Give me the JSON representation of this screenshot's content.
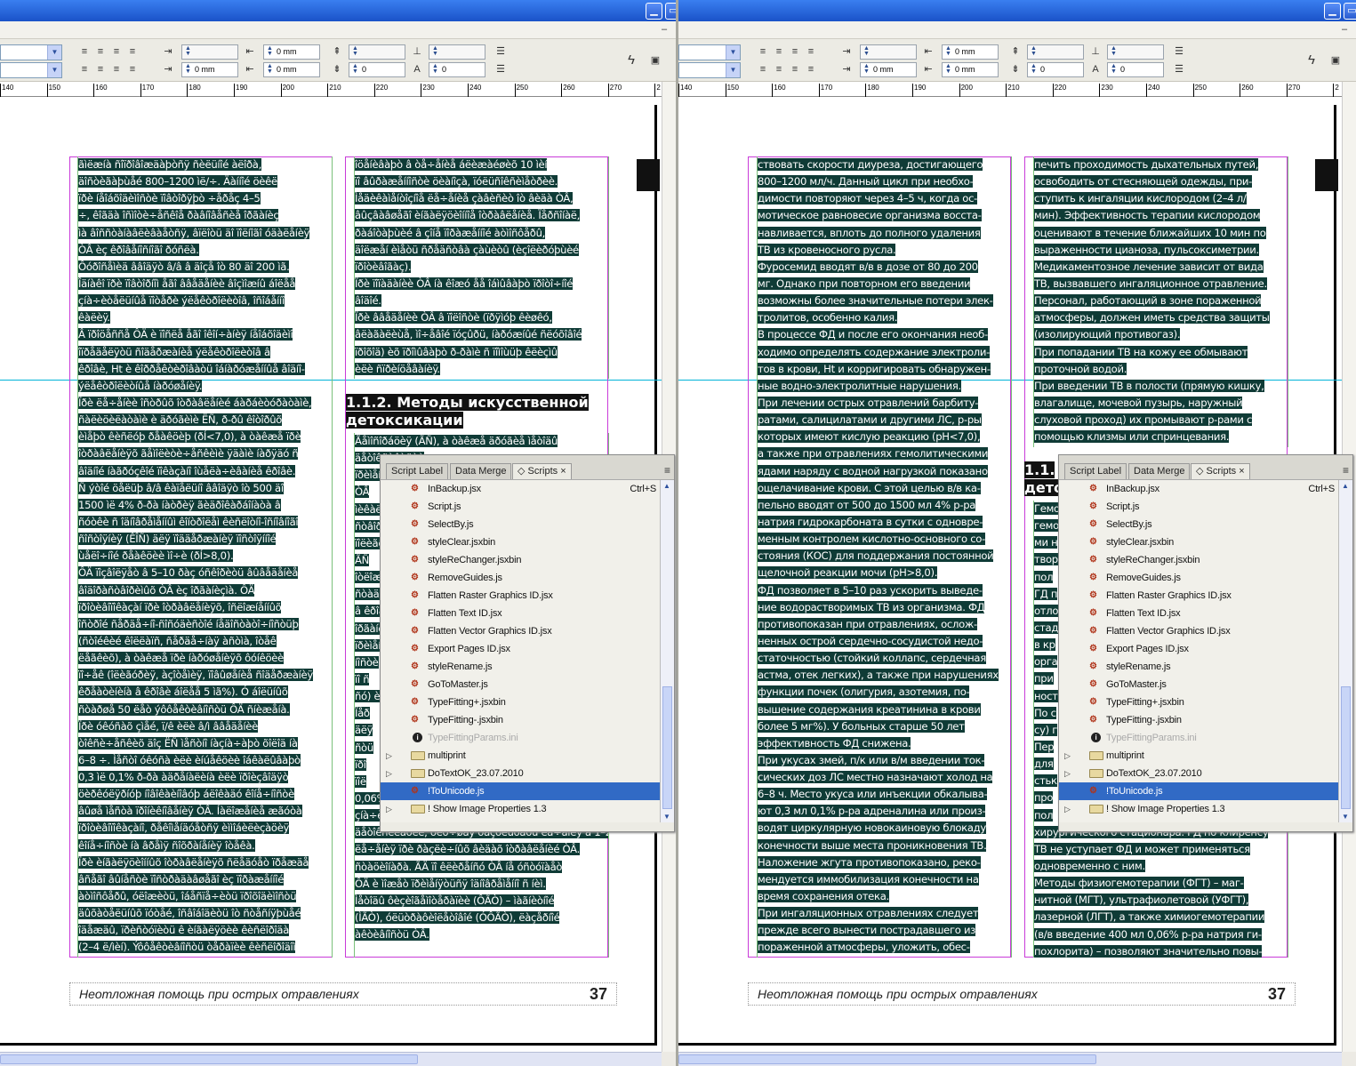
{
  "toolbar": {
    "row1": {
      "f1": "",
      "f2": "0 mm",
      "f3": "",
      "f4": ""
    },
    "row2": {
      "f1": "0 mm",
      "f2": "0 mm",
      "f3": "0",
      "f4": "0"
    }
  },
  "ruler_ticks_left": [
    "140",
    "150",
    "160",
    "170",
    "180",
    "190",
    "200",
    "210",
    "220",
    "230",
    "240",
    "250",
    "260",
    "270",
    "2"
  ],
  "ruler_ticks_right": [
    "140",
    "150",
    "160",
    "170",
    "180",
    "190",
    "200",
    "210",
    "220",
    "230",
    "240",
    "250",
    "260",
    "270",
    "2"
  ],
  "left_page": {
    "col1_lines": [
      "ãìëæíà ñîïðîâîæäàþòñÿ ñèëüíîé àëîðà,",
      "äîñòèãàþùåé 800–1200 ìë/÷. Äàííîé öèêë",
      "ïðè íåîáõîäèìîñòè ïîâòîðÿþò ÷åðåç 4–5",
      "÷, êîãäà îñìîòè÷åñêîå ðàâíîâåñèå îðãàíèç",
      "ìà âîññòàíàâëèâàåòñÿ, âïëîòü äî ïîëíîãî óäàëåíèÿ",
      "ÒÂ èç êðîâåíîñíîãî ðóñëà.",
      "Ôóðîñåìèä ââîäÿò â/â â äîçå îò 80 äî 200 ìã.",
      "Îäíàêî ïðè ïîâòîðíîì åãî ââåäåíèè âîçìîæíû áîëåå",
      "çíà÷èòåëüíûå ïîòåðè ýëåêòðîëèòîâ, îñîáåííî",
      "êàëèÿ.",
      "Â ïðîöåññå ÔÄ è ïîñëå åãî îêîí÷àíèÿ íåîáõîäèìî",
      "îïðåäåëÿòü ñîäåðæàíèå ýëåêòðîëèòîâ â",
      "êðîâè, Ht è êîððåêòèðîâàòü îáíàðóæåííûå âîäíî-",
      "ýëåêòðîëèòíûå íàðóøåíèÿ.",
      "Ïðè ëå÷åíèè îñòðûõ îòðàâëåíèé áàðáèòóðàòàìè,",
      "ñàëèöèëàòàìè è äðóãèìè ËÑ, ð-ðû êîòîðûõ",
      "èìåþò êèñëóþ ðåàêöèþ (ðÍ<7,0), à òàêæå ïðè",
      "îòðàâëåíèÿõ ãåìîëèòè÷åñêèìè ÿäàìè íàðÿäó ñ",
      "âîäíîé íàãðóçêîé ïîêàçàíî îùåëà÷èâàíèå êðîâè.",
      "Ñ ýòîé öåëüþ â/â êàïåëüíî ââîäÿò îò 500 äî",
      "1500 ìë 4% ð-ðà íàòðèÿ ãèäðîêàðáîíàòà â",
      "ñóòêè ñ îäíîâðåìåííûì êîíòðîëåì êèñëîòíî-îñíîâíîãî",
      "ñîñòîÿíèÿ (ÊÎÑ) äëÿ ïîääåðæàíèÿ ïîñòîÿííîé",
      "ùåëî÷íîé ðåàêöèè ìî÷è (ðÍ>8,0).",
      "ÔÄ ïîçâîëÿåò â 5–10 ðàç óñêîðèòü âûâåäåíèå",
      "âîäîðàñòâîðèìûõ ÒÂ èç îðãàíèçìà. ÔÄ",
      "ïðîòèâîïîêàçàí ïðè îòðàâëåíèÿõ, îñëîæíåííûõ",
      "îñòðîé ñåðäå÷íî-ñîñóäèñòîé íåäîñòàòî÷íîñòüþ",
      "(ñòîéêèé êîëëàïñ, ñåðäå÷íàÿ àñòìà, îòåê",
      "ëåãêèõ), à òàêæå ïðè íàðóøåíèÿõ ôóíêöèè",
      "ïî÷åê (îëèãóðèÿ, àçîòåìèÿ, ïîâûøåíèå ñîäåðæàíèÿ",
      "êðåàòèíèíà â êðîâè áîëåå 5 ìã%). Ó áîëüíûõ",
      "ñòàðøå 50 ëåò ýôôåêòèâíîñòü ÔÄ ñíèæåíà.",
      "Ïðè óêóñàõ çìåé, ï/ê èëè â/ì ââåäåíèè",
      "òîêñè÷åñêèõ äîç ËÑ ìåñòíî íàçíà÷àþò õîëîä íà",
      "6–8 ÷. Ìåñòî óêóñà èëè èíúåêöèè îáêàëûâàþò",
      "0,3 ìë 0,1% ð-ðà àäðåíàëèíà èëè ïðîèçâîäÿò",
      "öèðêóëÿðíóþ íîâîêàèíîâóþ áëîêàäó êîíå÷íîñòè",
      "âûøå ìåñòà ïðîíèêíîâåíèÿ ÒÂ. Íàëîæåíèå æãóòà",
      "ïðîòèâîïîêàçàíî, ðåêîìåíäóåòñÿ èììîáèëèçàöèÿ",
      "êîíå÷íîñòè íà âðåìÿ ñîõðàíåíèÿ îòåêà.",
      "Ïðè èíãàëÿöèîííûõ îòðàâëåíèÿõ ñëåäóåò ïðåæäå",
      "âñåãî âûíåñòè ïîñòðàäàâøåãî èç ïîðàæåííîé",
      "àòìîñôåðû, óëîæèòü, îáåñïå÷èòü ïðîõîäèìîñòü",
      "äûõàòåëüíûõ ïóòåé, îñâîáîäèòü îò ñòåñíÿþùåé",
      "îäåæäû, ïðèñòóïèòü ê èíãàëÿöèè êèñëîðîäà",
      "(2–4 ë/ìèí). Ýôôåêòèâíîñòü òåðàïèè êèñëîðîäîì"
    ],
    "col2_lines": [
      "îöåíèâàþò â òå÷åíèå áëèæàéøèõ 10 ìèí",
      "ïî âûðàæåííîñòè öèàíîçà, ïóëüñîêñèìåòðèè.",
      "Ìåäèêàìåíòîçíîå ëå÷åíèå çàâèñèò îò âèäà ÒÂ,",
      "âûçâàâøåãî èíãàëÿöèîííîå îòðàâëåíèå. Ïåðñîíàë,",
      "ðàáîòàþùèé â çîíå ïîðàæåííîé àòìîñôåðû,",
      "äîëæåí èìåòü ñðåäñòâà çàùèòû (èçîëèðóþùèé",
      "ïðîòèâîãàç).",
      "Ïðè ïîïàäàíèè ÒÂ íà êîæó åå îáìûâàþò ïðîòî÷íîé",
      "âîäîé.",
      "Ïðè ââåäåíèè ÒÂ â ïîëîñòè (ïðÿìóþ êèøêó,",
      "âëàãàëèùå, ìî÷åâîé ïóçûðü, íàðóæíûé ñëóõîâîé",
      "ïðîõîä) èõ ïðîìûâàþò ð-ðàìè ñ ïîìîùüþ êëèçìû",
      "èëè ñïðèíöåâàíèÿ."
    ],
    "heading": [
      "1.1.2. Методы искусственной",
      "детоксикации"
    ],
    "col2_lower_lines": [
      "Ãåìîñîðáöèÿ (ÃÑ), à òàêæå äðóãèå ìåòîäû",
      "äåòîêñèêàöèè",
      "ïðèìåíÿþòñÿ",
      "ÒÂ",
      "ìèêàëüíûõ",
      "ñòâîðèìûõ",
      "ïîëèãðàôèè",
      "ÃÑ",
      "îòëîæèòü",
      "ñòàäèè",
      "â êðîâè",
      "îðãàíèçì",
      "ïðèìåíÿþò",
      "íîñòè",
      "ïî ñ",
      "ñó) è",
      "Ïåð",
      "äëÿ",
      "ñòü",
      "ïðî",
      "ïîë",
      "0,06% ð-ðà íàòðèÿ ãèïîõëîðèòà) – ïîçâîëÿþò",
      "çíà÷èòåëüíî ïîâûñèòü ýôôåêòèâíîñòü äåòîêñèêàöèè",
      "äåòîêñèêàöèè, óëó÷øàÿ ðåçóëüòàòû ëå÷åíèÿ â 1–2 ðàçà",
      "ëå÷åíèÿ ïðè ðàçëè÷íûõ âèäàõ îòðàâëåíèé ÒÂ.",
      "ñòàöèîíàðà. ÃÄ ïî êëèðåíñó ÒÂ íå óñòóïàåò",
      "ÔÄ è ìîæåò ïðèìåíÿòüñÿ îäíîâðåìåííî ñ íèì.",
      "Ìåòîäû ôèçèîãåìîòåðàïèè (ÔÃÒ) – ìàãíèòíîé",
      "(ÌÃÒ), óëüòðàôèîëåòîâîé (ÓÔÃÒ), ëàçåðíîé",
      "àêòèâíîñòü ÒÂ."
    ],
    "footer_title": "Неотложная помощь при острых отравлениях",
    "page_number": "37"
  },
  "right_page": {
    "col1_lines": [
      "ствовать скорости диуреза, достигающего",
      "800–1200 мл/ч. Данный цикл при необхо-",
      "димости повторяют через 4–5 ч, когда ос-",
      "мотическое равновесие организма восста-",
      "навливается, вплоть до полного удаления",
      "ТВ из кровеносного русла.",
      "Фуросемид вводят в/в в дозе от 80 до 200",
      "мг. Однако при повторном его введении",
      "возможны более значительные потери элек-",
      "тролитов, особенно калия.",
      "В процессе ФД и после его окончания необ-",
      "ходимо определять содержание электроли-",
      "тов в крови, Ht и корригировать обнаружен-",
      "ные водно-электролитные нарушения.",
      "При лечении острых отравлений барбиту-",
      "ратами, салицилатами и другими ЛС, р-ры",
      "которых имеют кислую реакцию (pH<7,0),",
      "а также при отравлениях гемолитическими",
      "ядами наряду с водной нагрузкой показано",
      "ощелачивание крови. С этой целью в/в ка-",
      "пельно вводят от 500 до 1500 мл 4% р-ра",
      "натрия гидрокарбоната в сутки с одновре-",
      "менным контролем кислотно-основного со-",
      "стояния (КОС) для поддержания постоянной",
      "щелочной реакции мочи (pH>8,0).",
      "ФД позволяет в 5–10 раз ускорить выведе-",
      "ние водорастворимых ТВ из организма. ФД",
      "противопоказан при отравлениях, ослож-",
      "ненных острой сердечно-сосудистой недо-",
      "статочностью (стойкий коллапс, сердечная",
      "астма, отек легких), а также при нарушениях",
      "функции почек (олигурия, азотемия, по-",
      "вышение содержания креатинина в крови",
      "более 5 мг%). У больных старше 50 лет",
      "эффективность ФД снижена.",
      "При укусах змей, п/к или в/м введении ток-",
      "сических доз ЛС местно назначают холод на",
      "6–8 ч. Место укуса или инъекции обкалыва-",
      "ют 0,3 мл 0,1% р-ра адреналина или произ-",
      "водят циркулярную новокаиновую блокаду",
      "конечности выше места проникновения ТВ.",
      "Наложение жгута противопоказано, реко-",
      "мендуется иммобилизация конечности на",
      "время сохранения отека.",
      "При ингаляционных отравлениях следует",
      "прежде всего вынести пострадавшего из",
      "пораженной атмосферы, уложить, обес-"
    ],
    "col2_lines": [
      "печить проходимость дыхательных путей,",
      "освободить от стесняющей одежды, при-",
      "ступить к ингаляции кислородом (2–4 л/",
      "мин). Эффективность терапии кислородом",
      "оценивают в течение ближайших 10 мин по",
      "выраженности цианоза, пульсоксиметрии.",
      "Медикаментозное лечение зависит от вида",
      "ТВ, вызвавшего ингаляционное отравление.",
      "Персонал, работающий в зоне пораженной",
      "атмосферы, должен иметь средства защиты",
      "(изолирующий противогаз).",
      "При попадании ТВ на кожу ее обмывают",
      "проточной водой.",
      "При введении ТВ в полости (прямую кишку,",
      "влагалище, мочевой пузырь, наружный",
      "слуховой проход) их промывают р-рами с",
      "помощью клизмы или спринцевания."
    ],
    "heading_partial": [
      "1.1.",
      "дето"
    ],
    "col2_lower_lines": [
      "Гемо",
      "гемо",
      "ми н",
      "твор",
      "пол",
      "ГД п",
      "отло",
      "стад",
      "в кр",
      "орга",
      "при",
      "ност",
      "По с",
      "су) г",
      "Пер",
      "для",
      "стьк",
      "про",
      "пол",
      "хирургического стационара. ГД по клиренсу",
      "ТВ не уступает ФД и может применяться",
      "одновременно с ним.",
      "Методы физиогемотерапии (ФГТ) – маг-",
      "нитной (МГТ), ультрафиолетовой (УФГТ),",
      "лазерной (ЛГТ), а также химиогемотерапии",
      "(в/в введение 400 мл 0,06% р-ра натрия ги-",
      "похлорита) – позволяют значительно повы-"
    ],
    "footer_title": "Неотложная помощь при острых отравлениях",
    "page_number": "37"
  },
  "scripts_panel": {
    "tabs": [
      "Script Label",
      "Data Merge",
      "Scripts"
    ],
    "shortcut": "Ctrl+S",
    "items": [
      {
        "label": "InBackup.jsx",
        "type": "script"
      },
      {
        "label": "Script.js",
        "type": "script"
      },
      {
        "label": "SelectBy.js",
        "type": "script"
      },
      {
        "label": "styleClear.jsxbin",
        "type": "script"
      },
      {
        "label": "styleReChanger.jsxbin",
        "type": "script"
      },
      {
        "label": "RemoveGuides.js",
        "type": "script"
      },
      {
        "label": "Flatten Raster Graphics ID.jsx",
        "type": "script"
      },
      {
        "label": "Flatten Text ID.jsx",
        "type": "script"
      },
      {
        "label": "Flatten Vector Graphics ID.jsx",
        "type": "script"
      },
      {
        "label": "Export Pages ID.jsx",
        "type": "script"
      },
      {
        "label": "styleRename.js",
        "type": "script"
      },
      {
        "label": "GoToMaster.js",
        "type": "script"
      },
      {
        "label": "TypeFitting+.jsxbin",
        "type": "script"
      },
      {
        "label": "TypeFitting-.jsxbin",
        "type": "script"
      },
      {
        "label": "TypeFittingParams.ini",
        "type": "ini"
      },
      {
        "label": "multiprint",
        "type": "folder"
      },
      {
        "label": "DoTextOK_23.07.2010",
        "type": "folder"
      },
      {
        "label": "!ToUnicode.js",
        "type": "script",
        "selected": true
      },
      {
        "label": "! Show Image Properties 1.3",
        "type": "folder"
      }
    ]
  }
}
